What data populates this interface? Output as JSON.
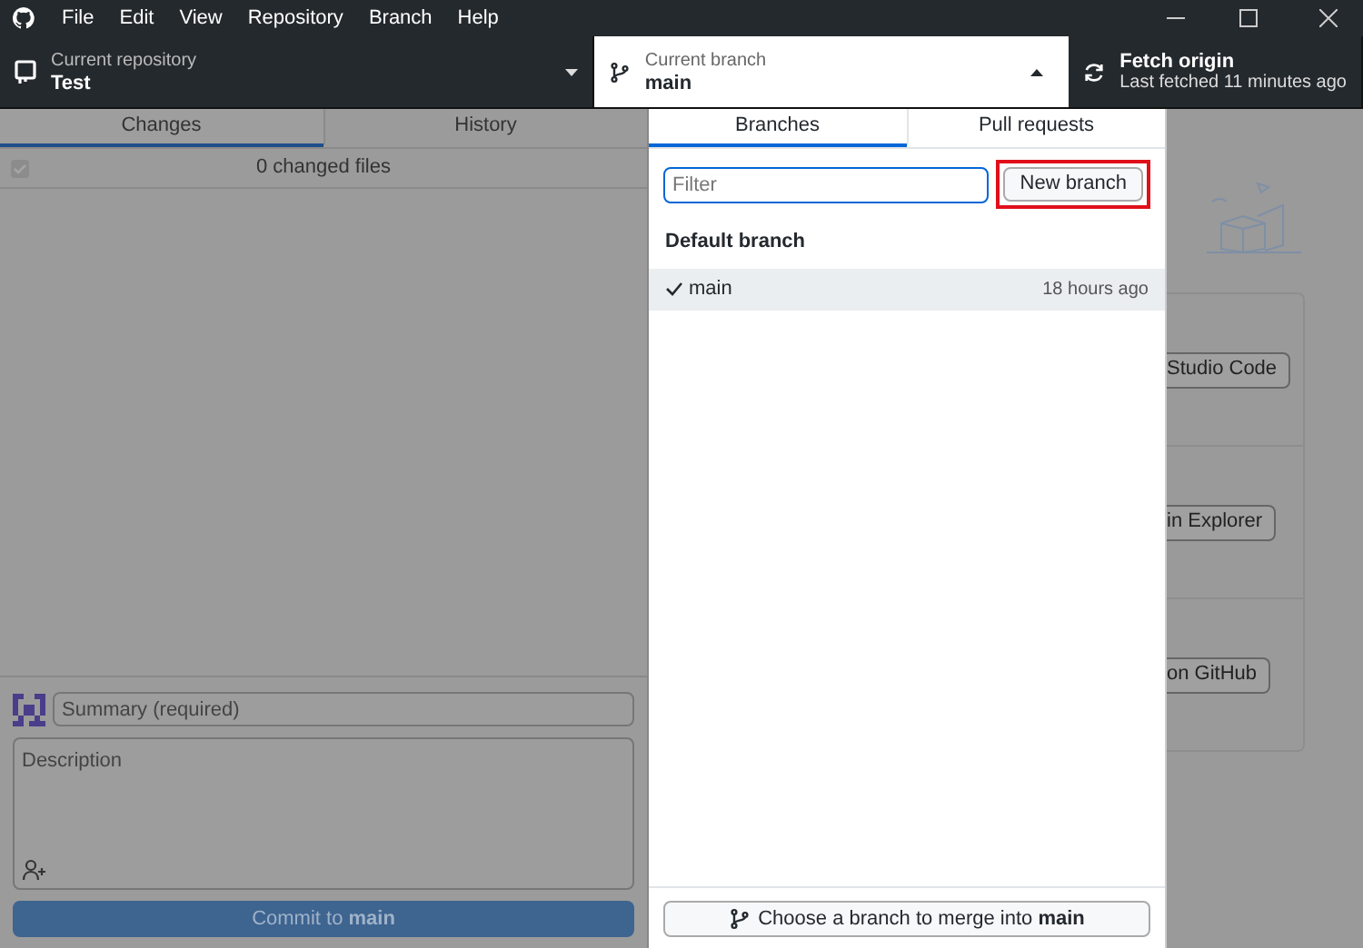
{
  "menu_bar": {
    "items": [
      "File",
      "Edit",
      "View",
      "Repository",
      "Branch",
      "Help"
    ]
  },
  "toolbar": {
    "repository": {
      "label": "Current repository",
      "value": "Test"
    },
    "branch": {
      "label": "Current branch",
      "value": "main",
      "expanded": true
    },
    "fetch": {
      "title": "Fetch origin",
      "subtitle": "Last fetched 11 minutes ago"
    }
  },
  "left_pane": {
    "tabs": [
      {
        "label": "Changes",
        "selected": true
      },
      {
        "label": "History",
        "selected": false
      }
    ],
    "select_all": {
      "checked": true,
      "disabled": true
    },
    "changed_files": "0 changed files",
    "summary": {
      "placeholder": "Summary (required)"
    },
    "description": {
      "placeholder": "Description"
    },
    "commit_button": {
      "label": "Commit to **main**",
      "disabled": true
    }
  },
  "branch_dropdown": {
    "tabs": [
      {
        "label": "Branches",
        "selected": true
      },
      {
        "label": "Pull requests",
        "selected": false
      }
    ],
    "filter": {
      "placeholder": "Filter"
    },
    "new_branch_button": {
      "label": "New branch",
      "highlighted": true
    },
    "sections": [
      {
        "title": "Default branch",
        "branches": [
          {
            "name": "main",
            "time": "18 hours ago",
            "selected": true
          }
        ]
      }
    ],
    "merge_button": "Choose a branch to merge into **main**"
  },
  "right_pane": {
    "actions": [
      "Studio Code",
      "in Explorer",
      "on GitHub"
    ]
  }
}
